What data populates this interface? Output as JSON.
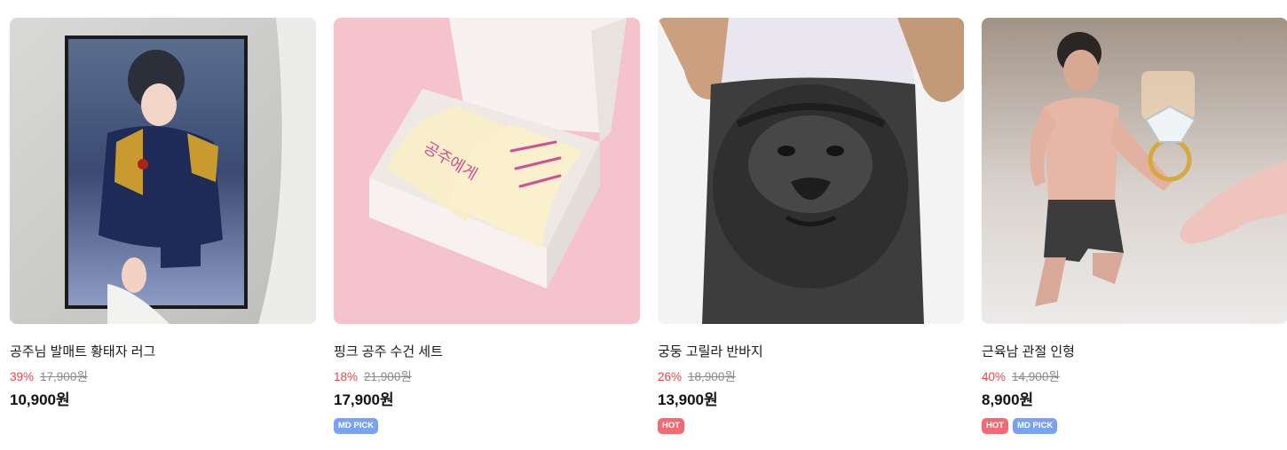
{
  "products": [
    {
      "name": "공주님 발매트 황태자 러그",
      "discount": "39%",
      "original_price": "17,900원",
      "sale_price": "10,900원",
      "badges": []
    },
    {
      "name": "핑크 공주 수건 세트",
      "discount": "18%",
      "original_price": "21,900원",
      "sale_price": "17,900원",
      "badges": [
        "MD PICK"
      ],
      "image_text": "공주에게"
    },
    {
      "name": "궁둥 고릴라 반바지",
      "discount": "26%",
      "original_price": "18,900원",
      "sale_price": "13,900원",
      "badges": [
        "HOT"
      ]
    },
    {
      "name": "근육남 관절 인형",
      "discount": "40%",
      "original_price": "14,900원",
      "sale_price": "8,900원",
      "badges": [
        "HOT",
        "MD PICK"
      ]
    }
  ],
  "colors": {
    "discount": "#e9454e",
    "hot_badge": "#f26b73",
    "md_pick_badge": "#7aa2f0"
  }
}
